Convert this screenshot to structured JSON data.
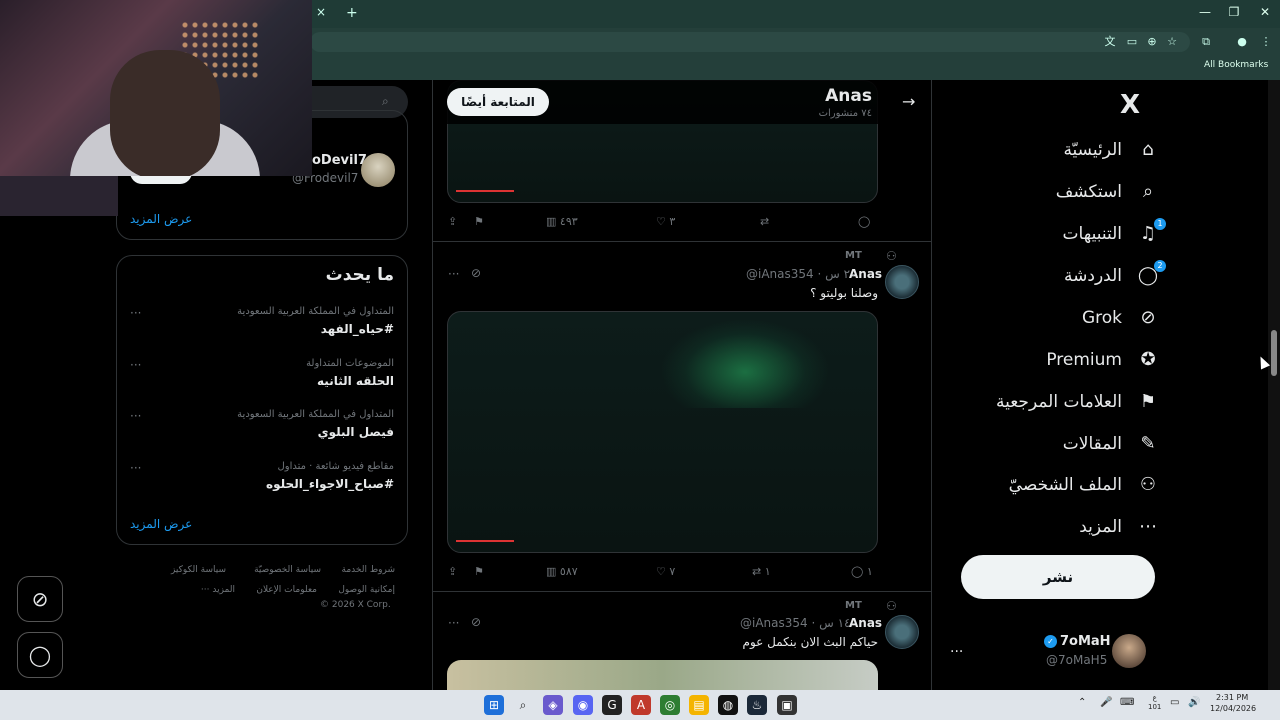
{
  "browser": {
    "tab_close": "×",
    "new_tab": "+",
    "minimize": "—",
    "maximize": "❐",
    "close": "✕",
    "all_bookmarks": "All Bookmarks"
  },
  "sidebar_right_nav": {
    "items": [
      {
        "label": "الرئيسيّة",
        "icon": "home-icon",
        "glyph": "⌂"
      },
      {
        "label": "استكشف",
        "icon": "search-icon",
        "glyph": "⌕"
      },
      {
        "label": "التنبيهات",
        "icon": "bell-icon",
        "glyph": "🔔",
        "badge": "1"
      },
      {
        "label": "الدردشة",
        "icon": "chat-icon",
        "glyph": "◯",
        "badge": "2"
      },
      {
        "label": "Grok",
        "icon": "grok-icon",
        "glyph": "⊘"
      },
      {
        "label": "Premium",
        "icon": "premium-icon",
        "glyph": "✪"
      },
      {
        "label": "العلامات المرجعية",
        "icon": "bookmark-icon",
        "glyph": "⚑"
      },
      {
        "label": "المقالات",
        "icon": "articles-icon",
        "glyph": "✎"
      },
      {
        "label": "الملف الشخصيّ",
        "icon": "profile-icon",
        "glyph": "⚇"
      },
      {
        "label": "المزيد",
        "icon": "more-icon",
        "glyph": "⋯"
      }
    ],
    "post_button": "نشر",
    "account": {
      "name": "7oMaH",
      "handle": "@7oMaH5",
      "more": "..."
    }
  },
  "profile_header": {
    "name": "Anas",
    "posts": "٧٤ منشورات",
    "follow_back": "المتابعة أيضًا",
    "back": "→"
  },
  "feed": {
    "tweet0_actions": {
      "views": "٤٩٣",
      "likes": "٣",
      "retweets": "",
      "replies": ""
    },
    "tweets": [
      {
        "retweet_label": "MT",
        "name": "Anas",
        "handle_time": "@iAnas354 · ٢٠ س",
        "text": "وصلنا بوليتو ؟",
        "actions": {
          "views": "٥٨٧",
          "likes": "٧",
          "retweets": "١",
          "replies": "١"
        }
      },
      {
        "retweet_label": "MT",
        "name": "Anas",
        "handle_time": "@iAnas354 · ١٤ س",
        "text": "حياكم البث الان بنكمل عوم"
      }
    ]
  },
  "left_column": {
    "who_to_follow": {
      "name": "oDevil7",
      "handle": "@Frodevil7",
      "show_more": "عرض المزيد"
    },
    "trends": {
      "title": "ما يحدث",
      "items": [
        {
          "meta": "المتداول في المملكة العربية السعودية",
          "name": "#حياه_الفهد"
        },
        {
          "meta": "الموضوعات المتداولة",
          "name": "الحلقه الثانيه"
        },
        {
          "meta": "المتداول في المملكة العربية السعودية",
          "name": "فيصل البلوي"
        },
        {
          "meta": "مقاطع فيديو شائعة · متداول",
          "name": "#صباح_الاجواء_الحلوه"
        }
      ],
      "show_more": "عرض المزيد"
    },
    "footer": {
      "links": [
        "شروط الخدمة",
        "سياسة الخصوصيّة",
        "سياسة الكوكيز",
        "إمكانية الوصول",
        "معلومات الإعلان",
        "المزيد ···"
      ],
      "copyright": "© 2026 X Corp."
    }
  },
  "taskbar": {
    "time": "2:31 PM",
    "date": "12/04/2026",
    "lang_top": "ع",
    "lang_bottom": "101"
  },
  "colors": {
    "accent": "#1d9bf0",
    "background": "#000000",
    "chrome": "#1f3b36"
  }
}
